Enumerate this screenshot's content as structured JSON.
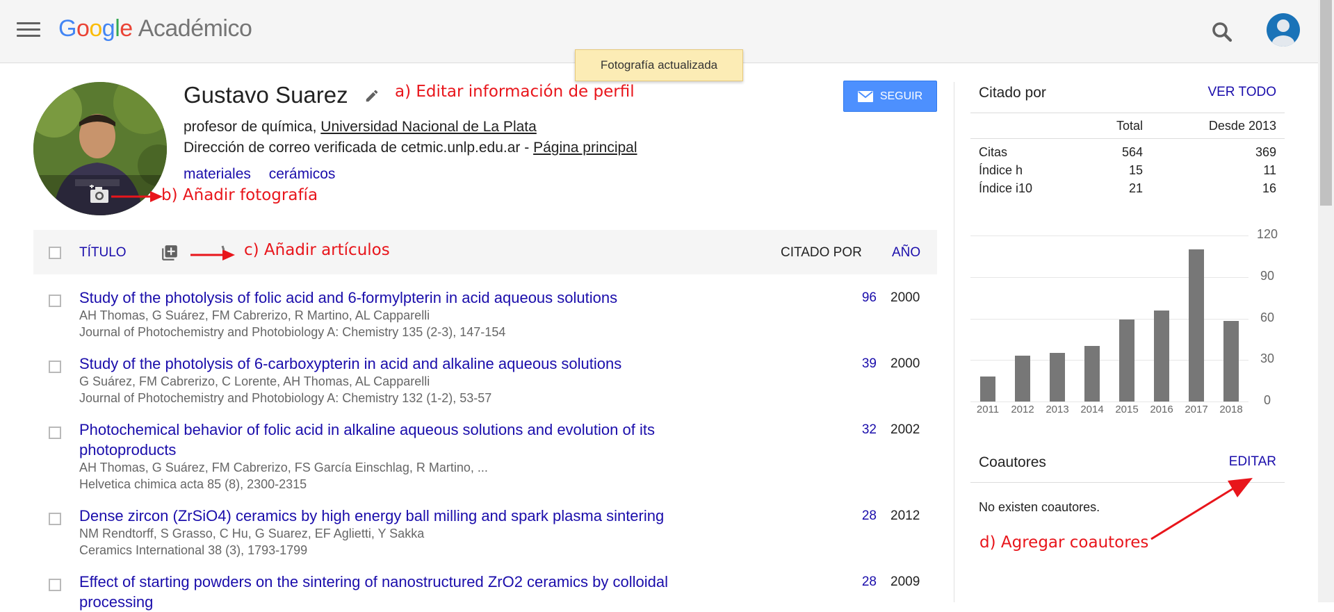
{
  "header": {
    "logo_letters": [
      "G",
      "o",
      "o",
      "g",
      "l",
      "e"
    ],
    "product": "Académico"
  },
  "toast": "Fotografía actualizada",
  "profile": {
    "name": "Gustavo Suarez",
    "position_prefix": "profesor de química,",
    "affiliation": "Universidad Nacional de La Plata",
    "email_text": "Dirección de correo verificada de cetmic.unlp.edu.ar -",
    "homepage": "Página principal",
    "interests": [
      "materiales",
      "cerámicos"
    ],
    "follow_label": "SEGUIR"
  },
  "annotations": {
    "a": "a) Editar información de perfil",
    "b": "b) Añadir fotografía",
    "c": "c) Añadir artículos",
    "d": "d) Agregar coautores"
  },
  "table": {
    "col_title": "TÍTULO",
    "col_cited": "CITADO POR",
    "col_year": "AÑO",
    "rows": [
      {
        "title": "Study of the photolysis of folic acid and 6-formylpterin in acid aqueous solutions",
        "authors": "AH Thomas, G Suárez, FM Cabrerizo, R Martino, AL Capparelli",
        "journal": "Journal of Photochemistry and Photobiology A: Chemistry 135 (2-3), 147-154",
        "cited": "96",
        "year": "2000"
      },
      {
        "title": "Study of the photolysis of 6-carboxypterin in acid and alkaline aqueous solutions",
        "authors": "G Suárez, FM Cabrerizo, C Lorente, AH Thomas, AL Capparelli",
        "journal": "Journal of Photochemistry and Photobiology A: Chemistry 132 (1-2), 53-57",
        "cited": "39",
        "year": "2000"
      },
      {
        "title": "Photochemical behavior of folic acid in alkaline aqueous solutions and evolution of its photoproducts",
        "authors": "AH Thomas, G Suárez, FM Cabrerizo, FS García Einschlag, R Martino, ...",
        "journal": "Helvetica chimica acta 85 (8), 2300-2315",
        "cited": "32",
        "year": "2002"
      },
      {
        "title": "Dense zircon (ZrSiO4) ceramics by high energy ball milling and spark plasma sintering",
        "authors": "NM Rendtorff, S Grasso, C Hu, G Suarez, EF Aglietti, Y Sakka",
        "journal": "Ceramics International 38 (3), 1793-1799",
        "cited": "28",
        "year": "2012"
      },
      {
        "title": "Effect of starting powders on the sintering of nanostructured ZrO2 ceramics by colloidal processing",
        "authors": "",
        "journal": "",
        "cited": "28",
        "year": "2009"
      }
    ]
  },
  "citations": {
    "title": "Citado por",
    "view_all": "VER TODO",
    "col_total": "Total",
    "col_since": "Desde 2013",
    "rows": [
      {
        "label": "Citas",
        "total": "564",
        "since": "369"
      },
      {
        "label": "Índice h",
        "total": "15",
        "since": "11"
      },
      {
        "label": "Índice i10",
        "total": "21",
        "since": "16"
      }
    ]
  },
  "chart_data": {
    "type": "bar",
    "categories": [
      "2011",
      "2012",
      "2013",
      "2014",
      "2015",
      "2016",
      "2017",
      "2018"
    ],
    "values": [
      18,
      33,
      35,
      40,
      59,
      66,
      110,
      58
    ],
    "yticks": [
      "0",
      "30",
      "60",
      "90",
      "120"
    ],
    "ylim": [
      0,
      120
    ],
    "grid": true
  },
  "coauthors": {
    "title": "Coautores",
    "edit": "EDITAR",
    "empty": "No existen coautores."
  },
  "colors": {
    "link": "#1a0dab",
    "annotation": "#e8151b",
    "follow_button": "#4d90fe",
    "bar": "#777777"
  }
}
